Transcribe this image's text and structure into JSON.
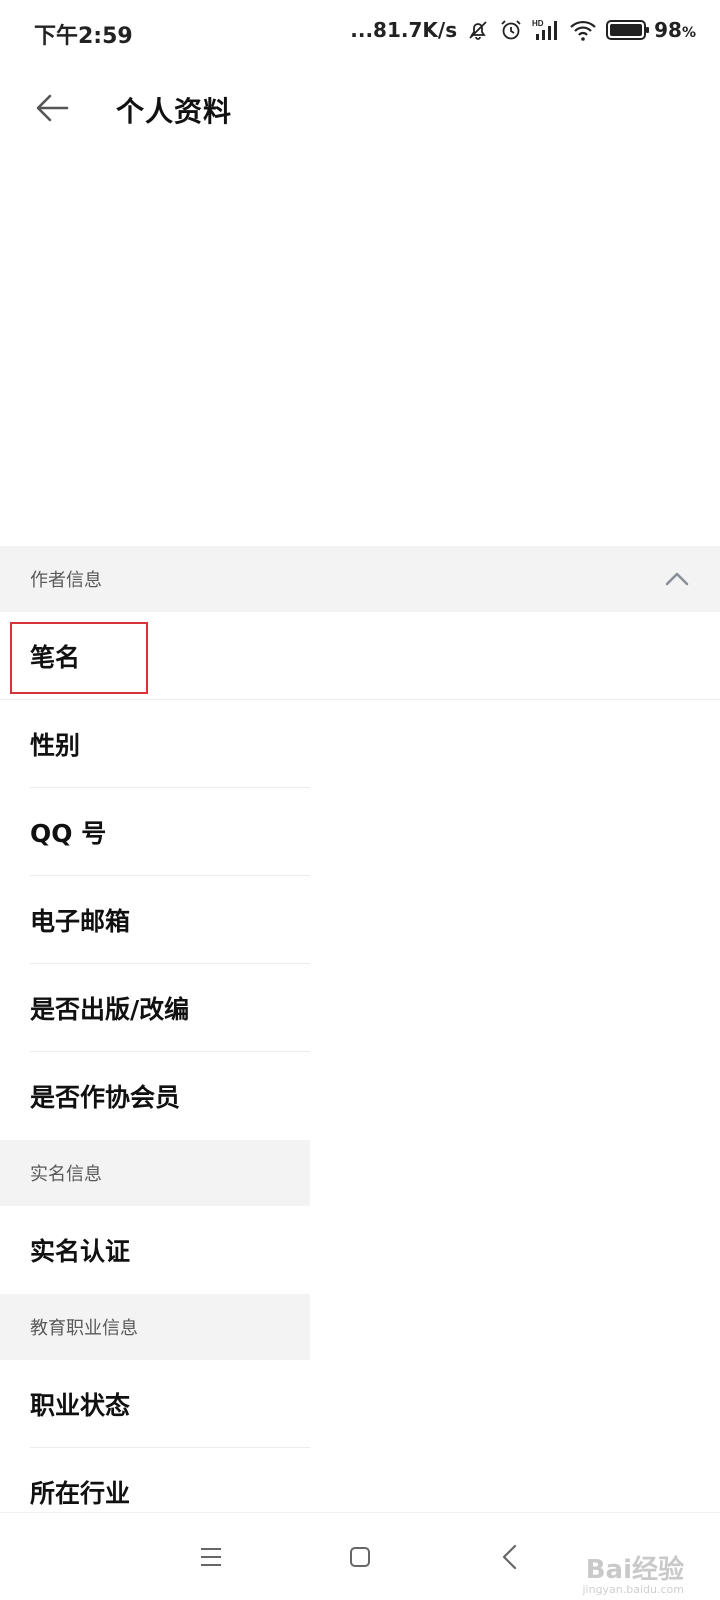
{
  "status_bar": {
    "time": "下午2:59",
    "network_speed": "...81.7K/s",
    "battery_percent": "98",
    "battery_unit": "%",
    "icons": [
      "mute-bell-icon",
      "alarm-icon",
      "hd-signal-icon",
      "wifi-icon",
      "battery-icon"
    ]
  },
  "header": {
    "title": "个人资料",
    "back_icon": "arrow-left-icon"
  },
  "sections": {
    "author": {
      "title": "作者信息",
      "items": [
        "笔名",
        "性别",
        "QQ 号",
        "电子邮箱",
        "是否出版/改编",
        "是否作协会员"
      ]
    },
    "realname": {
      "title": "实名信息",
      "items": [
        "实名认证"
      ]
    },
    "education": {
      "title": "教育职业信息",
      "items": [
        "职业状态",
        "所在行业"
      ]
    }
  },
  "colors": {
    "section_bg": "#f3f3f4",
    "highlight": "#d8333b",
    "text": "#111111"
  },
  "nav_bar": {
    "icons": [
      "menu-icon",
      "home-icon",
      "back-chevron-icon"
    ],
    "watermark": "Bai经验",
    "watermark_sub": "jingyan.baidu.com"
  }
}
